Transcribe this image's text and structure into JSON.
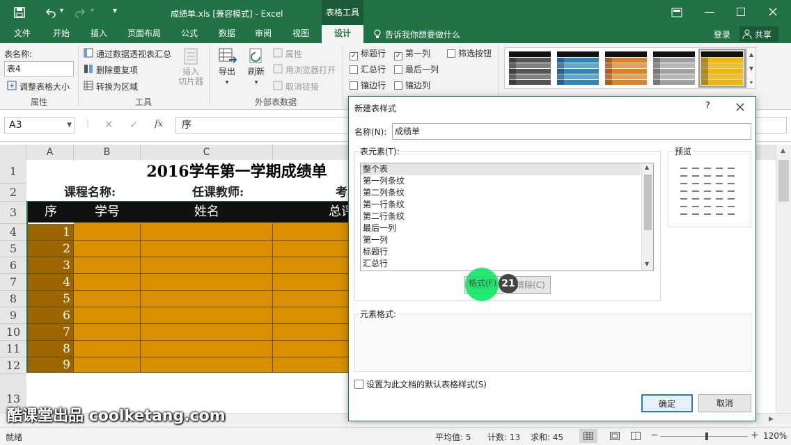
{
  "titlebar": {
    "doc_title": "成绩单.xls  [兼容模式] - Excel",
    "context_tab": "表格工具",
    "qa_dropdown": "▾"
  },
  "tabs": [
    "文件",
    "开始",
    "插入",
    "页面布局",
    "公式",
    "数据",
    "审阅",
    "视图",
    "设计"
  ],
  "active_tab": "设计",
  "tell_me": "告诉我你想要做什么",
  "login": "登录",
  "share": "共享",
  "ribbon": {
    "properties": {
      "table_name_label": "表名称:",
      "table_name_value": "表4",
      "resize": "调整表格大小",
      "group": "属性"
    },
    "tools": {
      "pivot": "通过数据透视表汇总",
      "remove_dup": "删除重复项",
      "convert": "转换为区域",
      "slicer": "插入\n切片器",
      "slicer_l1": "插入",
      "slicer_l2": "切片器",
      "group": "工具"
    },
    "external": {
      "export": "导出",
      "refresh": "刷新",
      "properties": "属性",
      "open_browser": "用浏览器打开",
      "unlink": "取消链接",
      "group": "外部表数据"
    },
    "style_options": {
      "header_row": "标题行",
      "first_col": "第一列",
      "filter_btn": "筛选按钮",
      "total_row": "汇总行",
      "last_col": "最后一列",
      "banded_rows": "镶边行",
      "banded_cols": "镶边列"
    },
    "styles": [
      {
        "color": "#555555"
      },
      {
        "color": "#2e86c1"
      },
      {
        "color": "#e67e22"
      },
      {
        "color": "#a0a0a0"
      },
      {
        "color": "#f1b800"
      }
    ]
  },
  "formula_bar": {
    "name_box": "A3",
    "fx": "fx",
    "content": "序"
  },
  "sheet": {
    "columns": [
      "A",
      "B",
      "C"
    ],
    "rows": [
      "1",
      "2",
      "3",
      "4",
      "5",
      "6",
      "7",
      "8",
      "9",
      "10",
      "11",
      "12",
      "13"
    ],
    "title": "2016学年第一学期成绩单",
    "course_label": "课程名称:",
    "teacher_label": "任课教师:",
    "exam_label": "考",
    "headers": [
      "序",
      "学号",
      "姓名",
      "总评"
    ],
    "serials": [
      "1",
      "2",
      "3",
      "4",
      "5",
      "6",
      "7",
      "8",
      "9"
    ]
  },
  "dialog": {
    "title": "新建表样式",
    "help": "?",
    "name_label": "名称(N):",
    "name_value": "成绩单",
    "elements_label": "表元素(T):",
    "elements": [
      "整个表",
      "第一列条纹",
      "第二列条纹",
      "第一行条纹",
      "第二行条纹",
      "最后一列",
      "第一列",
      "标题行",
      "汇总行"
    ],
    "preview_label": "预览",
    "format_btn": "格式(F)",
    "clear_btn": "清除(C)",
    "element_format_label": "元素格式:",
    "default_checkbox": "设置为此文档的默认表格样式(S)",
    "ok": "确定",
    "cancel": "取消"
  },
  "step_badge": "21",
  "status": {
    "ready": "就绪",
    "average": "平均值: 5",
    "count": "计数: 13",
    "sum": "求和: 45",
    "zoom": "120%"
  },
  "watermark": "酷课堂出品 coolketang.com"
}
